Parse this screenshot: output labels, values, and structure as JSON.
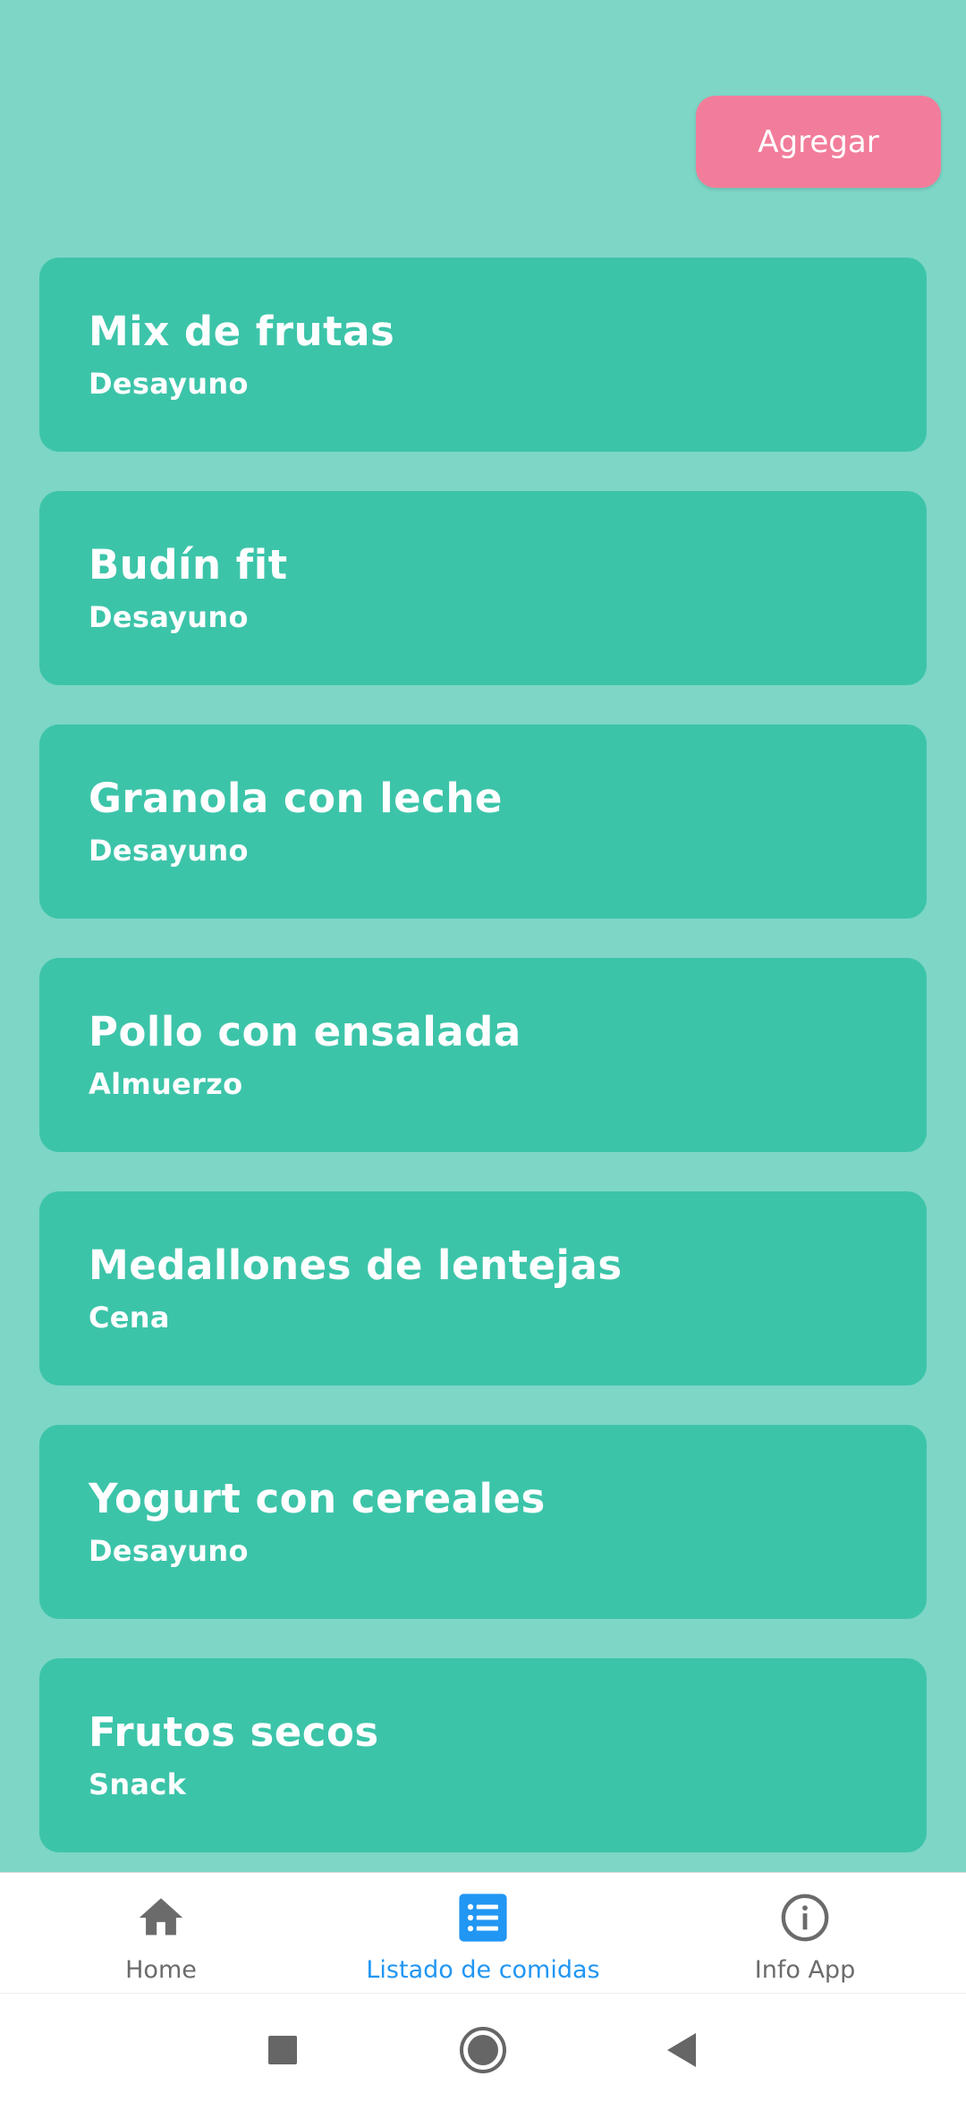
{
  "header": {
    "add_label": "Agregar"
  },
  "meals": [
    {
      "name": "Mix de frutas",
      "category": "Desayuno"
    },
    {
      "name": "Budín fit",
      "category": "Desayuno"
    },
    {
      "name": "Granola con leche",
      "category": "Desayuno"
    },
    {
      "name": "Pollo con ensalada",
      "category": "Almuerzo"
    },
    {
      "name": "Medallones de lentejas",
      "category": "Cena"
    },
    {
      "name": "Yogurt con cereales",
      "category": "Desayuno"
    },
    {
      "name": "Frutos secos",
      "category": "Snack"
    }
  ],
  "nav": {
    "items": [
      {
        "label": "Home",
        "icon": "home-icon",
        "active": false
      },
      {
        "label": "Listado de comidas",
        "icon": "list-icon",
        "active": true
      },
      {
        "label": "Info App",
        "icon": "info-icon",
        "active": false
      }
    ]
  },
  "colors": {
    "background": "#7dd6c6",
    "card": "#3cc4a9",
    "accent_button": "#f27d9b",
    "nav_active": "#2196f3",
    "nav_inactive": "#6b6b6b"
  }
}
